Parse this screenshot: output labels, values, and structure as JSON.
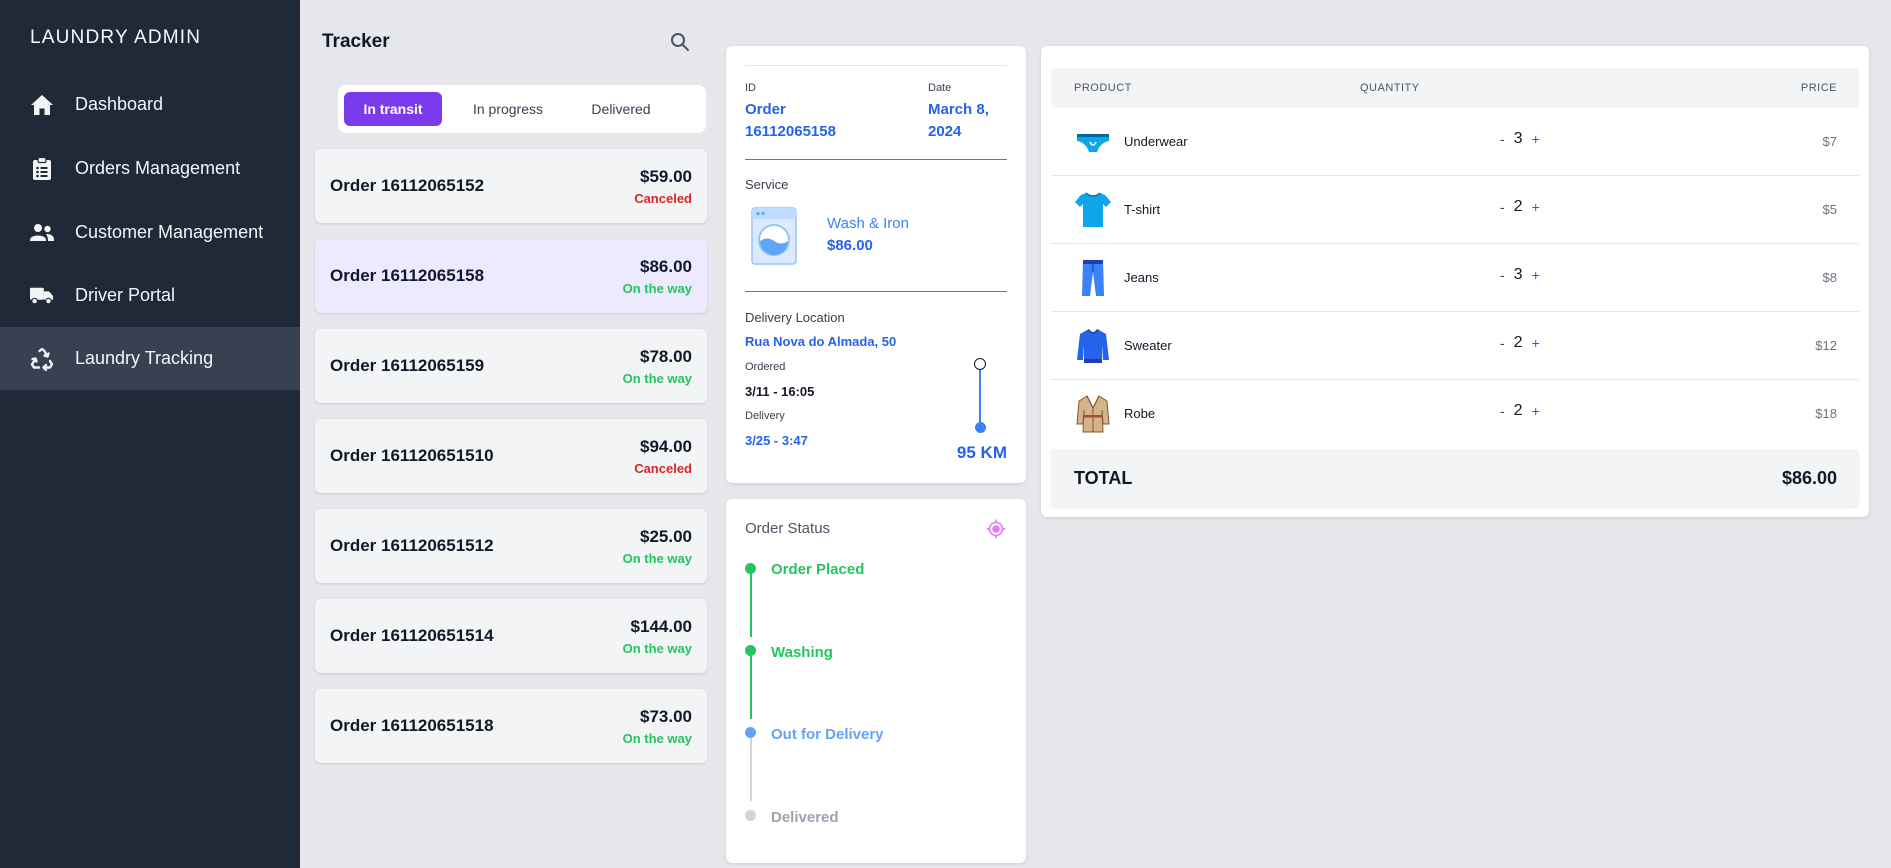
{
  "sidebar": {
    "brand": "LAUNDRY ADMIN",
    "items": [
      {
        "label": "Dashboard",
        "icon": "home-icon"
      },
      {
        "label": "Orders Management",
        "icon": "clipboard-icon"
      },
      {
        "label": "Customer Management",
        "icon": "users-icon"
      },
      {
        "label": "Driver Portal",
        "icon": "truck-icon"
      },
      {
        "label": "Laundry Tracking",
        "icon": "recycle-icon",
        "active": true
      }
    ]
  },
  "tracker": {
    "title": "Tracker",
    "tabs": [
      {
        "label": "In transit",
        "active": true
      },
      {
        "label": "In progress"
      },
      {
        "label": "Delivered"
      }
    ],
    "orders": [
      {
        "name": "Order 16112065152",
        "price": "$59.00",
        "status": "Canceled"
      },
      {
        "name": "Order 16112065158",
        "price": "$86.00",
        "status": "On the way",
        "selected": true
      },
      {
        "name": "Order 16112065159",
        "price": "$78.00",
        "status": "On the way"
      },
      {
        "name": "Order 161120651510",
        "price": "$94.00",
        "status": "Canceled"
      },
      {
        "name": "Order 161120651512",
        "price": "$25.00",
        "status": "On the way"
      },
      {
        "name": "Order 161120651514",
        "price": "$144.00",
        "status": "On the way"
      },
      {
        "name": "Order 161120651518",
        "price": "$73.00",
        "status": "On the way"
      }
    ]
  },
  "detail": {
    "id_label": "ID",
    "id_line1": "Order",
    "id_line2": "16112065158",
    "date_label": "Date",
    "date_line1": "March 8,",
    "date_line2": "2024",
    "service_label": "Service",
    "service_name": "Wash & Iron",
    "service_price": "$86.00",
    "location_label": "Delivery Location",
    "address": "Rua Nova do Almada, 50",
    "ordered_label": "Ordered",
    "ordered_value": "3/11 - 16:05",
    "delivery_label": "Delivery",
    "delivery_value": "3/25 - 3:47",
    "distance": "95 KM"
  },
  "order_status": {
    "title": "Order Status",
    "steps": [
      {
        "label": "Order Placed",
        "state": "done"
      },
      {
        "label": "Washing",
        "state": "done"
      },
      {
        "label": "Out for Delivery",
        "state": "current"
      },
      {
        "label": "Delivered",
        "state": "pending"
      }
    ]
  },
  "products": {
    "headers": {
      "product": "PRODUCT",
      "quantity": "QUANTITY",
      "price": "PRICE"
    },
    "rows": [
      {
        "name": "Underwear",
        "qty": "3",
        "price": "$7",
        "icon": "underwear-icon"
      },
      {
        "name": "T-shirt",
        "qty": "2",
        "price": "$5",
        "icon": "tshirt-icon"
      },
      {
        "name": "Jeans",
        "qty": "3",
        "price": "$8",
        "icon": "jeans-icon"
      },
      {
        "name": "Sweater",
        "qty": "2",
        "price": "$12",
        "icon": "sweater-icon"
      },
      {
        "name": "Robe",
        "qty": "2",
        "price": "$18",
        "icon": "robe-icon"
      }
    ],
    "minus": "-",
    "plus": "+",
    "total_label": "TOTAL",
    "total_value": "$86.00"
  },
  "colors": {
    "accent": "#7c3aed",
    "green": "#22c55e",
    "red": "#dc2626",
    "blue": "#2563eb"
  }
}
